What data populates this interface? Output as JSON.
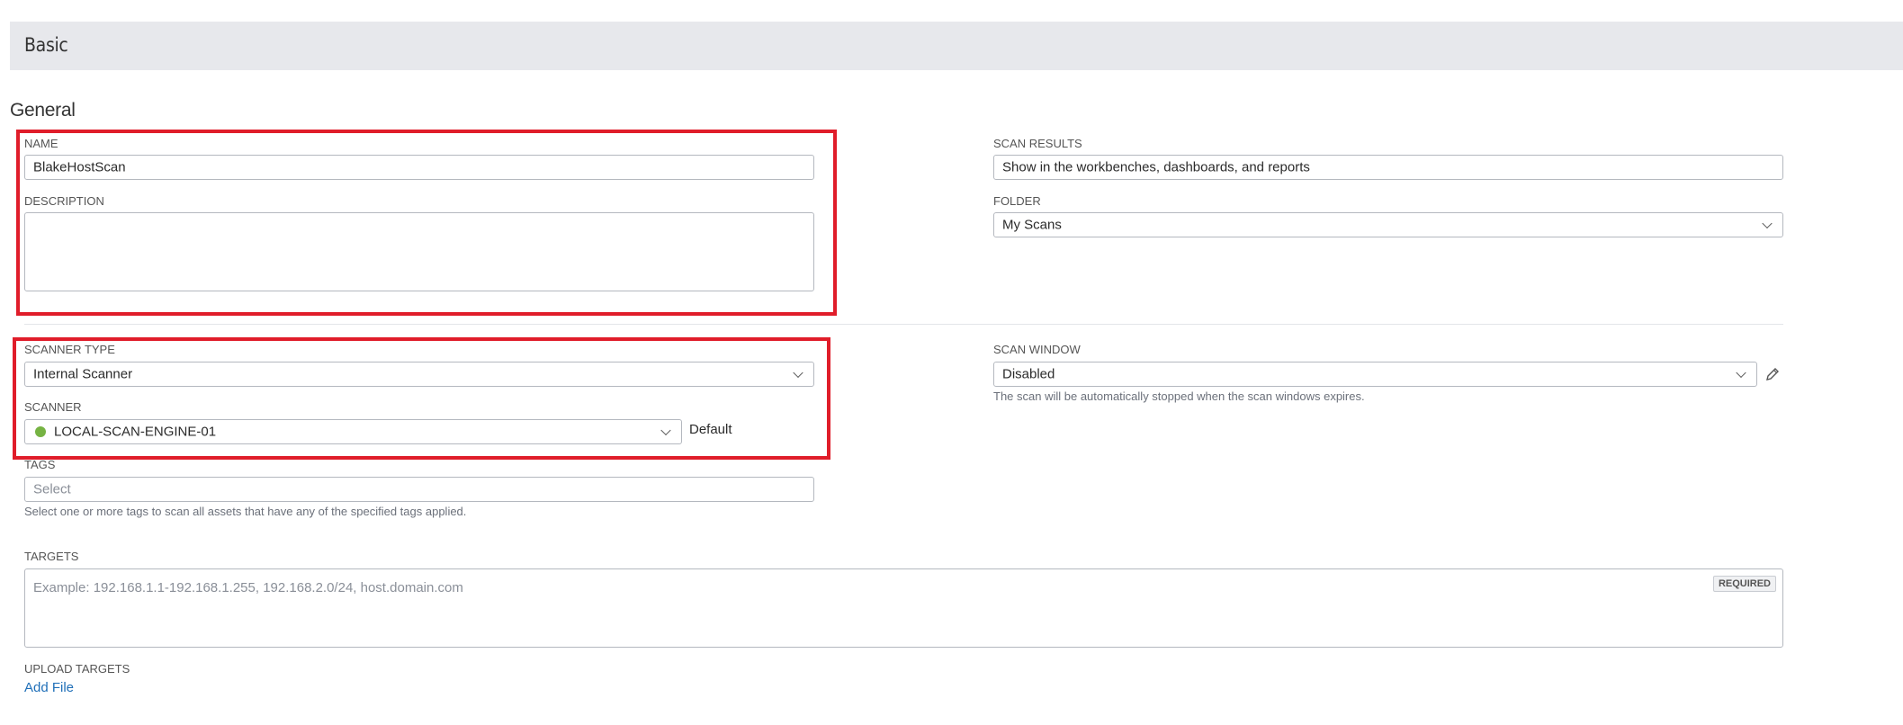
{
  "section": {
    "title": "Basic"
  },
  "general": {
    "title": "General"
  },
  "name": {
    "label": "NAME",
    "value": "BlakeHostScan"
  },
  "description": {
    "label": "DESCRIPTION",
    "value": ""
  },
  "scan_results": {
    "label": "SCAN RESULTS",
    "value": "Show in the workbenches, dashboards, and reports"
  },
  "folder": {
    "label": "FOLDER",
    "value": "My Scans"
  },
  "scanner_type": {
    "label": "SCANNER TYPE",
    "value": "Internal Scanner"
  },
  "scanner": {
    "label": "SCANNER",
    "value": "LOCAL-SCAN-ENGINE-01",
    "default_label": "Default",
    "status_color": "#76b343"
  },
  "scan_window": {
    "label": "SCAN WINDOW",
    "value": "Disabled",
    "hint": "The scan will be automatically stopped when the scan windows expires."
  },
  "tags": {
    "label": "TAGS",
    "placeholder": "Select",
    "hint": "Select one or more tags to scan all assets that have any of the specified tags applied."
  },
  "targets": {
    "label": "TARGETS",
    "placeholder": "Example: 192.168.1.1-192.168.1.255, 192.168.2.0/24, host.domain.com",
    "required_badge": "REQUIRED"
  },
  "upload_targets": {
    "label": "UPLOAD TARGETS",
    "add_file": "Add File"
  },
  "colors": {
    "highlight": "#e01d2a",
    "link": "#1f6fb8",
    "header_bg": "#e7e8ec"
  }
}
